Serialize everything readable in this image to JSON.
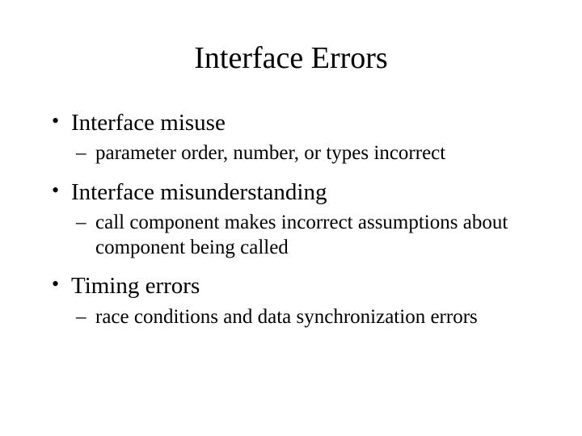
{
  "title": "Interface Errors",
  "bullets": [
    {
      "text": "Interface misuse",
      "sub": [
        "parameter order, number, or types incorrect"
      ]
    },
    {
      "text": "Interface misunderstanding",
      "sub": [
        "call component makes incorrect assumptions about component being called"
      ]
    },
    {
      "text": "Timing errors",
      "sub": [
        "race conditions and data synchronization errors"
      ]
    }
  ]
}
